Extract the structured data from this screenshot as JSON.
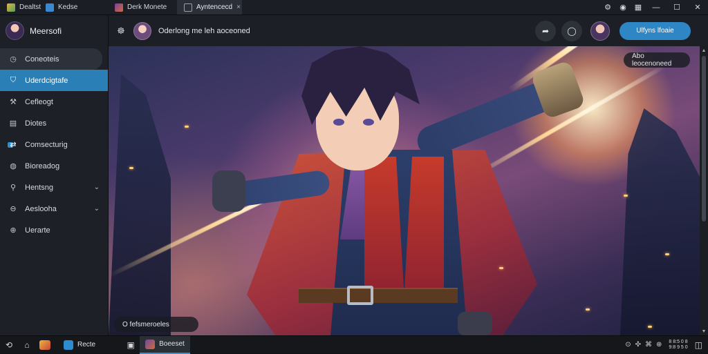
{
  "tabs": [
    {
      "label": "Dealtst",
      "icon": "app-icon"
    },
    {
      "label": "Kedse",
      "icon": "home-icon"
    },
    {
      "label": "Derk Monete",
      "icon": "game-icon"
    },
    {
      "label": "Ayntencecd",
      "icon": "document-icon",
      "active": true,
      "close": "×"
    }
  ],
  "window_controls": {
    "settings": "⚙",
    "profile": "◉",
    "grid": "▦",
    "minimize": "—",
    "maximize": "☐",
    "close": "✕"
  },
  "brand": {
    "name": "Meersofi"
  },
  "sidebar": {
    "items": [
      {
        "label": "Coneoteis",
        "icon": "clock-icon",
        "glyph": "◷",
        "state": "hover"
      },
      {
        "label": "Uderdcigtafe",
        "icon": "shield-icon",
        "glyph": "⛉",
        "state": "active"
      },
      {
        "label": "Cefleogt",
        "icon": "tools-icon",
        "glyph": "⚒"
      },
      {
        "label": "Diotes",
        "icon": "notes-icon",
        "glyph": "▤"
      },
      {
        "label": "Comsecturig",
        "icon": "share-icon",
        "glyph": "⇄",
        "dot": true
      },
      {
        "label": "Bioreadog",
        "icon": "compass-icon",
        "glyph": "◍"
      },
      {
        "label": "Hentsng",
        "icon": "search-icon",
        "glyph": "⚲",
        "chevron": "⌄"
      },
      {
        "label": "Aeslooha",
        "icon": "minus-circle-icon",
        "glyph": "⊖",
        "chevron": "⌄"
      },
      {
        "label": "Uerarte",
        "icon": "settings-icon",
        "glyph": "⊕"
      }
    ]
  },
  "header": {
    "back_glyph": "☸",
    "title": "Oderlong me leh aoceoned",
    "btn1_glyph": "➦",
    "btn2_glyph": "◯",
    "primary_label": "Ulfyns lfoaie"
  },
  "stage": {
    "top_chip": "Abo leocenoneed",
    "bottom_chip": "O fefsmeroeles"
  },
  "scrollbar": {
    "up": "▲",
    "down": "▼"
  },
  "taskbar": {
    "back_glyph": "⟲",
    "home_glyph": "⌂",
    "apps": [
      {
        "label": "Recte",
        "icon": "store-icon",
        "active": false
      },
      {
        "label": "Boeeset",
        "icon": "game-icon",
        "active": true
      }
    ],
    "extra_glyph": "▣",
    "tray": [
      "⊙",
      "✣",
      "⌘",
      "⊕"
    ],
    "time": "8 8:5 0 8",
    "date": "9:8 9 5 0",
    "notify_glyph": "◫"
  },
  "colors": {
    "accent": "#2f86c4",
    "sidebar_active": "#2a7fb6",
    "background": "#1c1f25"
  }
}
